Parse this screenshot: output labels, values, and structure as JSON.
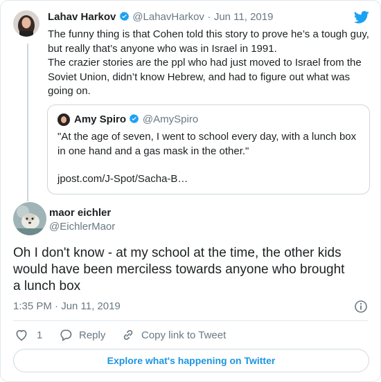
{
  "reply_tweet": {
    "author_name": "Lahav Harkov",
    "author_handle": "@LahavHarkov",
    "separator": "·",
    "date": "Jun 11, 2019",
    "lines": [
      "The funny thing is that Cohen told this story to prove he’s a tough guy,",
      "but really that’s anyone who was in Israel in 1991.",
      "The crazier stories are the ppl who had just moved to Israel from the",
      "Soviet Union, didn’t know Hebrew, and had to figure out what was",
      "going on."
    ]
  },
  "quoted_tweet": {
    "author_name": "Amy Spiro",
    "author_handle": "@AmySpiro",
    "lines": [
      "\"At the age of seven, I went to school every day, with a lunch box",
      "in one hand and a gas mask in the other.\""
    ],
    "link": "jpost.com/J-Spot/Sacha-B…"
  },
  "main_tweet": {
    "author_name": "maor eichler",
    "author_handle": "@EichlerMaor",
    "lines": [
      "Oh I don't know - at my school at the time, the other kids",
      "would have been merciless towards anyone who brought",
      "a lunch box"
    ],
    "timestamp": "1:35 PM · Jun 11, 2019"
  },
  "actions": {
    "like_count": "1",
    "reply_label": "Reply",
    "copy_link_label": "Copy link to Tweet"
  },
  "footer": {
    "explore_label": "Explore what's happening on Twitter"
  },
  "colors": {
    "brand_blue": "#1da1f2",
    "link_blue": "#1b95e0",
    "muted_gray": "#697882",
    "border_gray": "#e1e8ed"
  }
}
